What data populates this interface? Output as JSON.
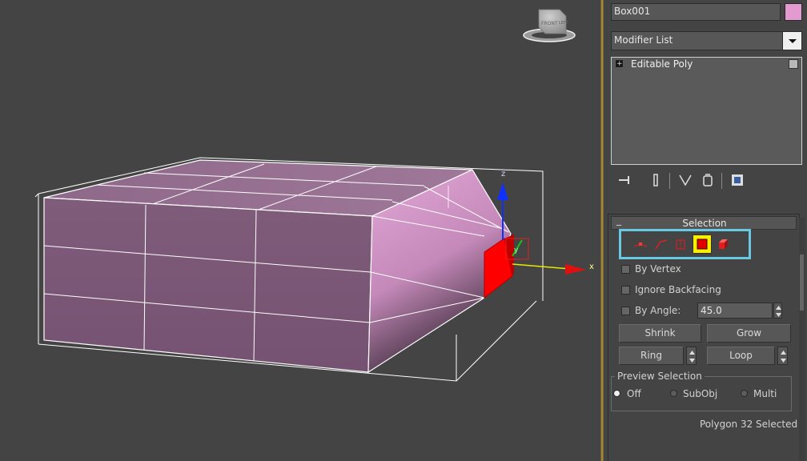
{
  "viewport": {
    "viewcube": {
      "face_label": "FRONT",
      "side_label": "LEFT"
    },
    "gizmo": {
      "x_axis": "x",
      "y_axis": "y",
      "z_axis": "z",
      "x_color": "#e01010",
      "y_color": "#18c018",
      "z_color": "#1030ff"
    },
    "colors": {
      "mesh": "#7d5877",
      "mesh_light": "#d59ac8",
      "edges": "#ffffff",
      "selected_face": "#ff0000"
    }
  },
  "panel": {
    "object_name": "Box001",
    "object_color": "#e39ad0",
    "modifier_list": "Modifier List",
    "stack": [
      {
        "label": "Editable Poly"
      }
    ],
    "stack_toolbar": [
      "pin-stack-icon",
      "show-end-result-icon",
      "make-unique-icon",
      "remove-modifier-icon",
      "configure-modifier-sets-icon"
    ],
    "selection": {
      "title": "Selection",
      "collapse_glyph": "_",
      "subobject_icons": [
        "vertex-icon",
        "edge-icon",
        "border-icon",
        "polygon-icon",
        "element-icon"
      ],
      "active_subobject": "polygon",
      "by_vertex": "By Vertex",
      "ignore_backfacing": "Ignore Backfacing",
      "by_angle": "By Angle:",
      "angle_value": "45.0",
      "shrink": "Shrink",
      "grow": "Grow",
      "ring": "Ring",
      "loop": "Loop",
      "preview_title": "Preview Selection",
      "preview_options": [
        "Off",
        "SubObj",
        "Multi"
      ],
      "preview_selected": "Off",
      "status": "Polygon 32 Selected"
    },
    "highlight_color": "#67c9e2"
  }
}
